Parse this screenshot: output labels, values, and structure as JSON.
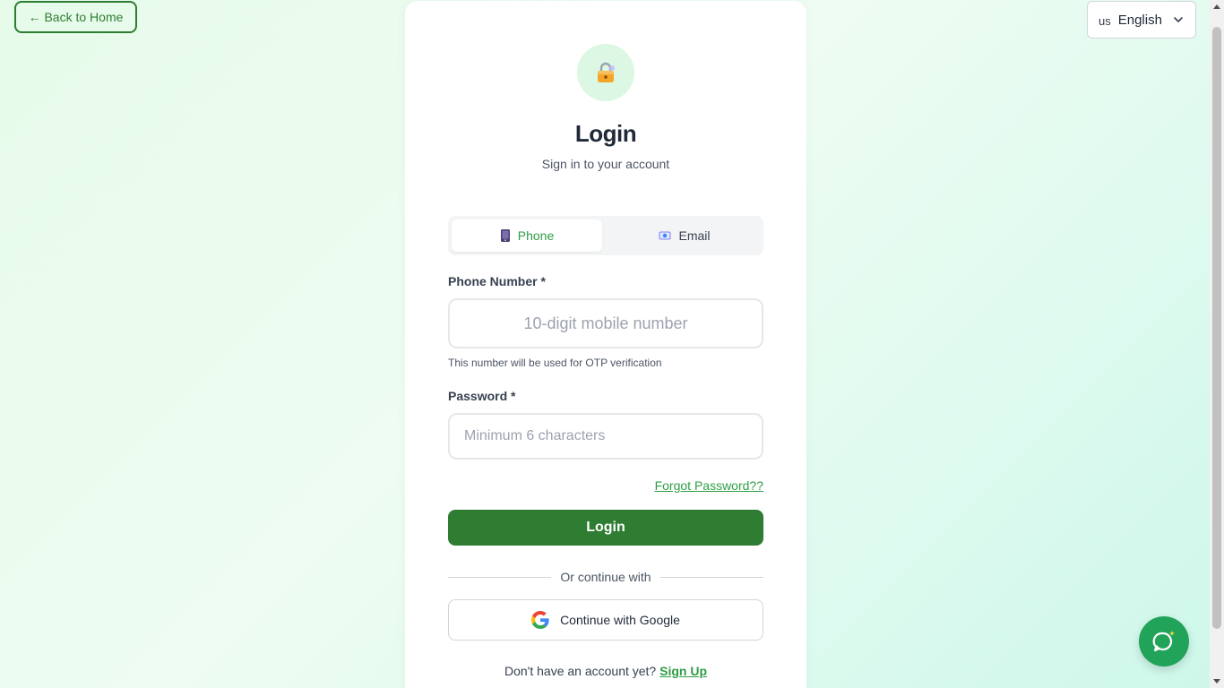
{
  "nav": {
    "back_label": "← Back to Home"
  },
  "language": {
    "flag_text": "us",
    "selected": "English",
    "icon": "chevron-down-icon"
  },
  "header": {
    "icon": "lock-icon",
    "title": "Login",
    "subtitle": "Sign in to your account"
  },
  "tabs": [
    {
      "label": "Phone",
      "icon": "mobile-phone-icon",
      "active": true
    },
    {
      "label": "Email",
      "icon": "email-icon",
      "active": false
    }
  ],
  "phone": {
    "label": "Phone Number *",
    "placeholder": "10-digit mobile number",
    "value": "",
    "helper": "This number will be used for OTP verification"
  },
  "password": {
    "label": "Password *",
    "placeholder": "Minimum 6 characters",
    "value": ""
  },
  "forgot_label": "Forgot Password??",
  "login_label": "Login",
  "divider_text": "Or continue with",
  "google_label": "Continue with Google",
  "signup": {
    "prompt": "Don't have an account yet?",
    "link": "Sign Up"
  },
  "chat_fab": {
    "icon": "chat-sparkle-icon"
  },
  "colors": {
    "primary": "#2e7d32",
    "accent_green": "#2e9d45",
    "fab": "#22a35a",
    "background_start": "#e6fbea",
    "background_end": "#cdf7ea"
  }
}
